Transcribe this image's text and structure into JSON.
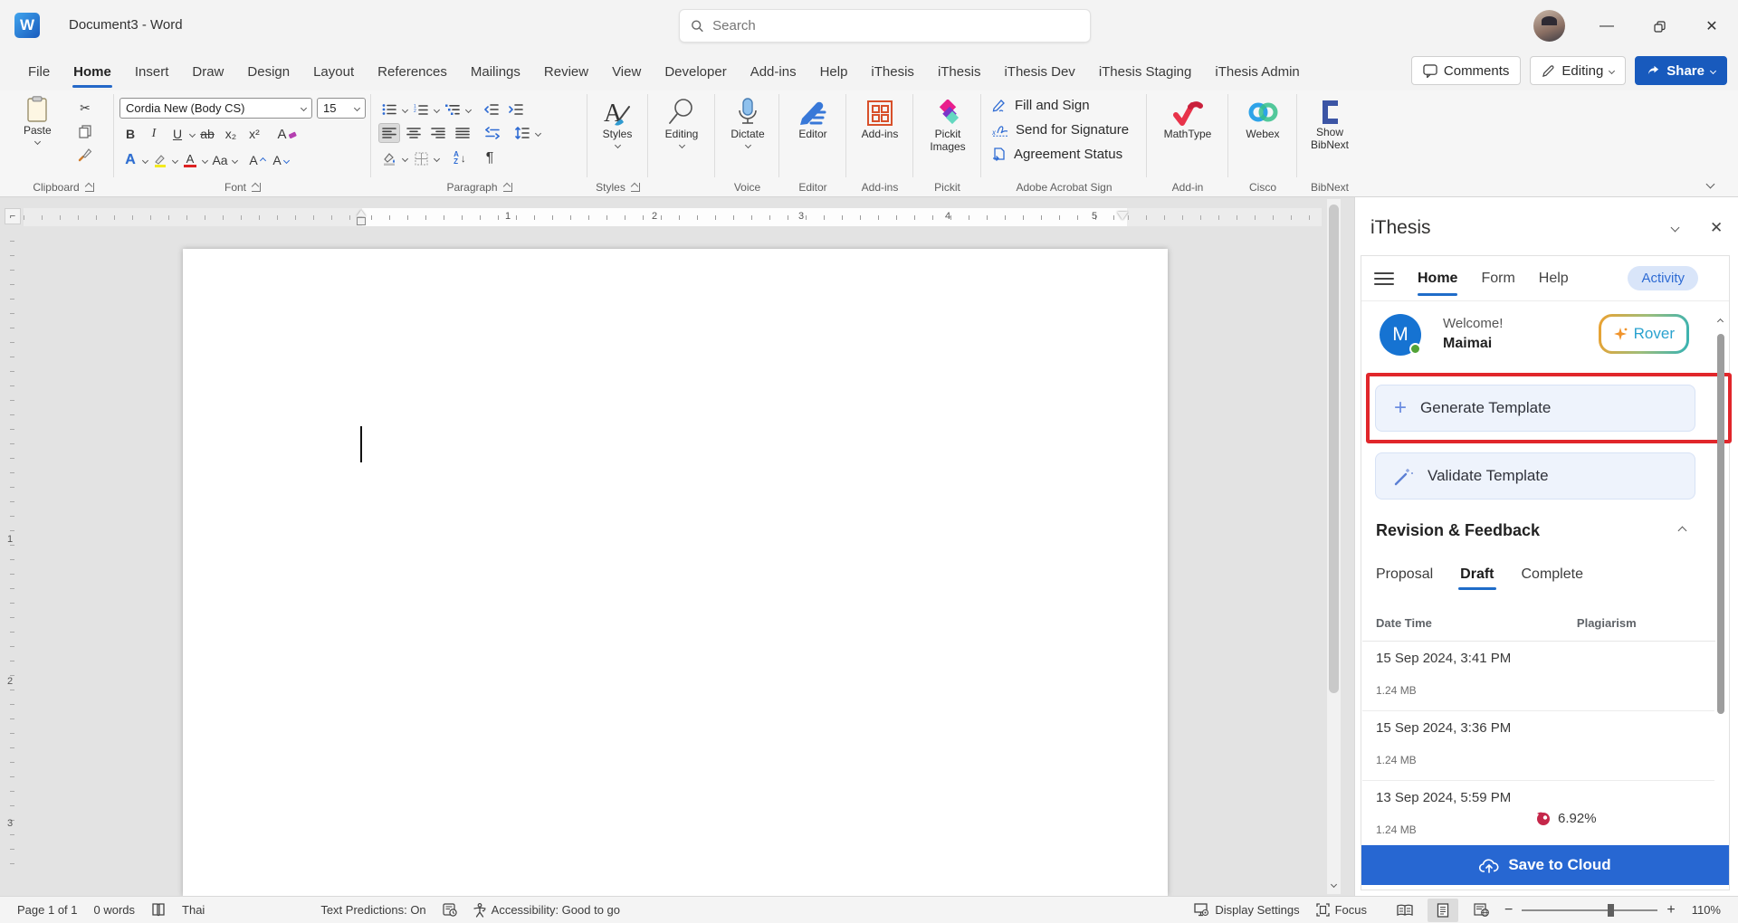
{
  "title_bar": {
    "title": "Document3 - Word",
    "search_placeholder": "Search"
  },
  "ribbon": {
    "tabs": [
      "File",
      "Home",
      "Insert",
      "Draw",
      "Design",
      "Layout",
      "References",
      "Mailings",
      "Review",
      "View",
      "Developer",
      "Add-ins",
      "Help",
      "iThesis",
      "iThesis",
      "iThesis Dev",
      "iThesis Staging",
      "iThesis Admin"
    ],
    "comments_label": "Comments",
    "editing_mode_label": "Editing",
    "share_label": "Share",
    "paste_label": "Paste",
    "font_name": "Cordia New (Body CS)",
    "font_size": "15",
    "bold": "B",
    "italic": "I",
    "underline": "U",
    "strike": "ab",
    "subscript": "x₂",
    "superscript": "x²",
    "case_label": "Aa",
    "styles_label": "Styles",
    "editing_group_label": "Editing",
    "dictate_label": "Dictate",
    "editor_label": "Editor",
    "addins_label": "Add-ins",
    "pickit_label": "Pickit Images",
    "fill_sign_label": "Fill and Sign",
    "send_signature_label": "Send for Signature",
    "agreement_label": "Agreement Status",
    "mathtype_label": "MathType",
    "webex_label": "Webex",
    "bibnext_label": "Show BibNext",
    "group_labels": [
      "Clipboard",
      "Font",
      "Paragraph",
      "Styles",
      "Voice",
      "Editor",
      "Add-ins",
      "Pickit",
      "Adobe Acrobat Sign",
      "Add-in",
      "Cisco",
      "BibNext"
    ]
  },
  "ruler": {
    "h": [
      "1",
      "2",
      "3",
      "4",
      "5"
    ],
    "v": [
      "1",
      "2",
      "3"
    ]
  },
  "panel": {
    "title": "iThesis",
    "tabs": [
      "Home",
      "Form",
      "Help"
    ],
    "activity_label": "Activity",
    "welcome_text": "Welcome!",
    "user_name": "Maimai",
    "avatar_initial": "M",
    "rover_label": "Rover",
    "generate_label": "Generate Template",
    "validate_label": "Validate Template",
    "section_title": "Revision & Feedback",
    "revision_tabs": [
      "Proposal",
      "Draft",
      "Complete"
    ],
    "columns": [
      "Date Time",
      "Plagiarism"
    ],
    "rows": [
      {
        "datetime": "15 Sep 2024, 3:41 PM",
        "size": "1.24 MB",
        "plagiarism": ""
      },
      {
        "datetime": "15 Sep 2024, 3:36 PM",
        "size": "1.24 MB",
        "plagiarism": ""
      },
      {
        "datetime": "13 Sep 2024, 5:59 PM",
        "size": "1.24 MB",
        "plagiarism": "6.92%"
      }
    ],
    "save_label": "Save to Cloud"
  },
  "status_bar": {
    "page_info": "Page 1 of 1",
    "word_count": "0 words",
    "language": "Thai",
    "predictions": "Text Predictions: On",
    "accessibility": "Accessibility: Good to go",
    "display_settings": "Display Settings",
    "focus": "Focus",
    "zoom_level": "110%"
  },
  "colors": {
    "word_blue": "#185abd",
    "tab_underline": "#2468c8",
    "annotation_red": "#e1262b",
    "save_button": "#2767d2",
    "turnitin_red": "#c5274a"
  }
}
